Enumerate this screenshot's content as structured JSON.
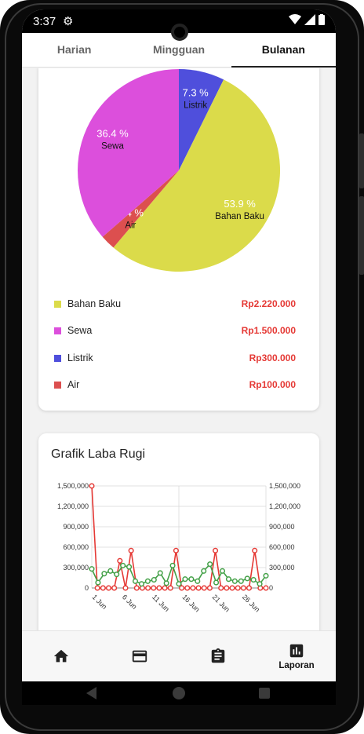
{
  "status_bar": {
    "time": "3:37"
  },
  "tabs": [
    {
      "label": "Harian",
      "active": false
    },
    {
      "label": "Mingguan",
      "active": false
    },
    {
      "label": "Bulanan",
      "active": true
    }
  ],
  "expense_card": {
    "items": [
      {
        "label": "Bahan Baku",
        "amount": "Rp2.220.000",
        "color": "#dbdb4a"
      },
      {
        "label": "Sewa",
        "amount": "Rp1.500.000",
        "color": "#dc4fdc"
      },
      {
        "label": "Listrik",
        "amount": "Rp300.000",
        "color": "#4f4fdc"
      },
      {
        "label": "Air",
        "amount": "Rp100.000",
        "color": "#dc4f4f"
      }
    ]
  },
  "chart_data": [
    {
      "type": "pie",
      "slices": [
        {
          "label": "Listrik",
          "percent": 7.3,
          "percent_label": "7.3 %",
          "color": "#4f4fdc"
        },
        {
          "label": "Bahan Baku",
          "percent": 53.9,
          "percent_label": "53.9 %",
          "color": "#dbdb4a"
        },
        {
          "label": "Air",
          "percent": 2.4,
          "percent_label": "2.4 %",
          "color": "#dc4f4f"
        },
        {
          "label": "Sewa",
          "percent": 36.4,
          "percent_label": "36.4 %",
          "color": "#dc4fdc"
        }
      ]
    },
    {
      "type": "line",
      "title": "Grafik Laba Rugi",
      "x_labels": [
        "1 Jun",
        "6 Jun",
        "11 Jun",
        "16 Jun",
        "21 Jun",
        "26 Jun"
      ],
      "y_ticks": [
        "0",
        "300,000",
        "600,000",
        "900,000",
        "1,200,000",
        "1,500,000"
      ],
      "ylim": [
        0,
        1500000
      ],
      "x_range": [
        1,
        30
      ],
      "series": [
        {
          "color": "#e53935",
          "values": [
            1500000,
            0,
            0,
            0,
            0,
            400000,
            0,
            550000,
            0,
            0,
            0,
            0,
            0,
            0,
            0,
            550000,
            0,
            0,
            0,
            0,
            0,
            0,
            550000,
            0,
            0,
            0,
            0,
            0,
            0,
            550000,
            0,
            0
          ]
        },
        {
          "color": "#43a047",
          "values": [
            280000,
            80000,
            210000,
            250000,
            200000,
            330000,
            310000,
            100000,
            60000,
            100000,
            120000,
            220000,
            70000,
            330000,
            60000,
            130000,
            130000,
            100000,
            250000,
            350000,
            80000,
            250000,
            130000,
            100000,
            100000,
            140000,
            120000,
            60000,
            180000
          ]
        }
      ]
    }
  ],
  "bottom_nav": [
    {
      "icon": "home-icon",
      "label": ""
    },
    {
      "icon": "credit-card-icon",
      "label": ""
    },
    {
      "icon": "clipboard-icon",
      "label": ""
    },
    {
      "icon": "bar-chart-icon",
      "label": "Laporan"
    }
  ]
}
